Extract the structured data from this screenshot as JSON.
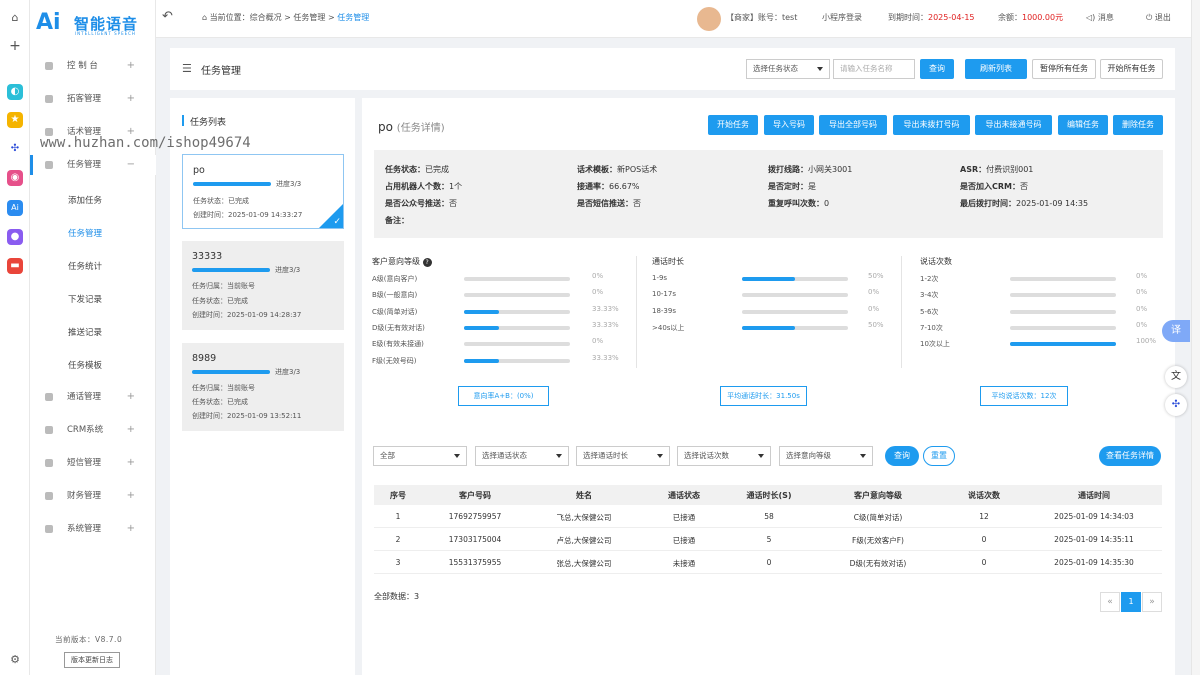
{
  "colors": {
    "accent": "#1e9bef",
    "danger": "#e02020"
  },
  "logo": {
    "ai": "Ai",
    "cn": "智能语音",
    "en": "INTELLIGENT SPEECH"
  },
  "sidebar": {
    "items": [
      {
        "label": "控 制 台",
        "icon": "dashboard-icon"
      },
      {
        "label": "拓客管理",
        "icon": "customer-icon"
      },
      {
        "label": "话术管理",
        "icon": "script-icon"
      },
      {
        "label": "任务管理",
        "icon": "task-icon"
      },
      {
        "label": "通话管理",
        "icon": "call-icon"
      },
      {
        "label": "CRM系统",
        "icon": "crm-icon"
      },
      {
        "label": "短信管理",
        "icon": "sms-icon"
      },
      {
        "label": "财务管理",
        "icon": "finance-icon"
      },
      {
        "label": "系统管理",
        "icon": "settings-icon"
      }
    ],
    "sub_items": [
      "添加任务",
      "任务管理",
      "任务统计",
      "下发记录",
      "推送记录",
      "任务模板"
    ],
    "version": "当前版本：V8.7.0",
    "changelog": "版本更新日志"
  },
  "topbar": {
    "breadcrumb_prefix": "当前位置：综合概况 > 任务管理 > ",
    "breadcrumb_current": "任务管理",
    "account": "【商家】账号：test",
    "miniapp": "小程序登录",
    "expire_label": "到期时间：",
    "expire_value": "2025-04-15",
    "balance_label": "余额：",
    "balance_value": "1000.00元",
    "message": "消息",
    "logout": "退出"
  },
  "watermark": "www.huzhan.com/ishop49674",
  "page": {
    "title": "任务管理",
    "status_select": "选择任务状态",
    "name_placeholder": "请输入任务名称",
    "query": "查询",
    "refresh": "刷新列表",
    "pause_all": "暂停所有任务",
    "start_all": "开始所有任务"
  },
  "task_list": {
    "title": "任务列表",
    "progress_label": "进度3/3",
    "tasks": [
      {
        "name": "po",
        "progress": 1.0,
        "lines": [
          "任务状态：已完成",
          "创建时间：2025-01-09 14:33:27"
        ]
      },
      {
        "name": "33333",
        "progress": 1.0,
        "lines": [
          "任务归属：当前账号",
          "任务状态：已完成",
          "创建时间：2025-01-09 14:28:37"
        ]
      },
      {
        "name": "8989",
        "progress": 1.0,
        "lines": [
          "任务归属：当前账号",
          "任务状态：已完成",
          "创建时间：2025-01-09 13:52:11"
        ]
      }
    ]
  },
  "detail": {
    "name": "po",
    "subtitle": "(任务详情)",
    "actions": [
      "开始任务",
      "导入号码",
      "导出全部号码",
      "导出未拨打号码",
      "导出未接通号码",
      "编辑任务",
      "删除任务"
    ],
    "info": [
      [
        {
          "k": "任务状态：",
          "v": "已完成"
        },
        {
          "k": "话术模板：",
          "v": "新POS话术"
        },
        {
          "k": "拨打线路：",
          "v": "小网关3001"
        },
        {
          "k": "ASR：",
          "v": "付费识别001"
        }
      ],
      [
        {
          "k": "占用机器人个数：",
          "v": "1个"
        },
        {
          "k": "接通率：",
          "v": "66.67%"
        },
        {
          "k": "是否定时：",
          "v": "是"
        },
        {
          "k": "是否加入CRM：",
          "v": "否"
        }
      ],
      [
        {
          "k": "是否公众号推送：",
          "v": "否"
        },
        {
          "k": "是否短信推送：",
          "v": "否"
        },
        {
          "k": "重复呼叫次数：",
          "v": "0"
        },
        {
          "k": "最后拨打时间：",
          "v": "2025-01-09 14:35"
        }
      ],
      [
        {
          "k": "备注：",
          "v": ""
        }
      ]
    ],
    "stats": [
      {
        "title": "客户意向等级",
        "rows": [
          {
            "label": "A级(意向客户)",
            "value": 0,
            "pct": "0%"
          },
          {
            "label": "B级(一般意向)",
            "value": 0,
            "pct": "0%"
          },
          {
            "label": "C级(简单对话)",
            "value": 33.33,
            "pct": "33.33%"
          },
          {
            "label": "D级(无有效对话)",
            "value": 33.33,
            "pct": "33.33%"
          },
          {
            "label": "E级(有效未接通)",
            "value": 0,
            "pct": "0%"
          },
          {
            "label": "F级(无效号码)",
            "value": 33.33,
            "pct": "33.33%"
          }
        ],
        "summary": "意向率A+B：(0%)"
      },
      {
        "title": "通话时长",
        "rows": [
          {
            "label": "1-9s",
            "value": 50,
            "pct": "50%"
          },
          {
            "label": "10-17s",
            "value": 0,
            "pct": "0%"
          },
          {
            "label": "18-39s",
            "value": 0,
            "pct": "0%"
          },
          {
            "label": ">40s以上",
            "value": 50,
            "pct": "50%"
          }
        ],
        "summary": "平均通话时长：31.50s"
      },
      {
        "title": "说话次数",
        "rows": [
          {
            "label": "1-2次",
            "value": 0,
            "pct": "0%"
          },
          {
            "label": "3-4次",
            "value": 0,
            "pct": "0%"
          },
          {
            "label": "5-6次",
            "value": 0,
            "pct": "0%"
          },
          {
            "label": "7-10次",
            "value": 0,
            "pct": "0%"
          },
          {
            "label": "10次以上",
            "value": 100,
            "pct": "100%"
          }
        ],
        "summary": "平均说话次数：12次"
      }
    ],
    "filters": [
      "全部",
      "选择通话状态",
      "选择通话时长",
      "选择说话次数",
      "选择意向等级"
    ],
    "query": "查询",
    "reset": "重置",
    "view_detail": "查看任务详情",
    "table": {
      "headers": [
        "序号",
        "客户号码",
        "姓名",
        "通话状态",
        "通话时长(S)",
        "客户意向等级",
        "说话次数",
        "通话时间"
      ],
      "rows": [
        [
          "1",
          "17692759957",
          "飞总,大保健公司",
          "已接通",
          "58",
          "C级(简单对话)",
          "12",
          "2025-01-09 14:34:03"
        ],
        [
          "2",
          "17303175004",
          "卢总,大保健公司",
          "已接通",
          "5",
          "F级(无效客户F)",
          "0",
          "2025-01-09 14:35:11"
        ],
        [
          "3",
          "15531375955",
          "张总,大保健公司",
          "未接通",
          "0",
          "D级(无有效对话)",
          "0",
          "2025-01-09 14:35:30"
        ]
      ]
    },
    "total": "全部数据：3",
    "pagination": {
      "prev": "«",
      "page": "1",
      "next": "»"
    }
  },
  "float": {
    "translate": "译"
  }
}
